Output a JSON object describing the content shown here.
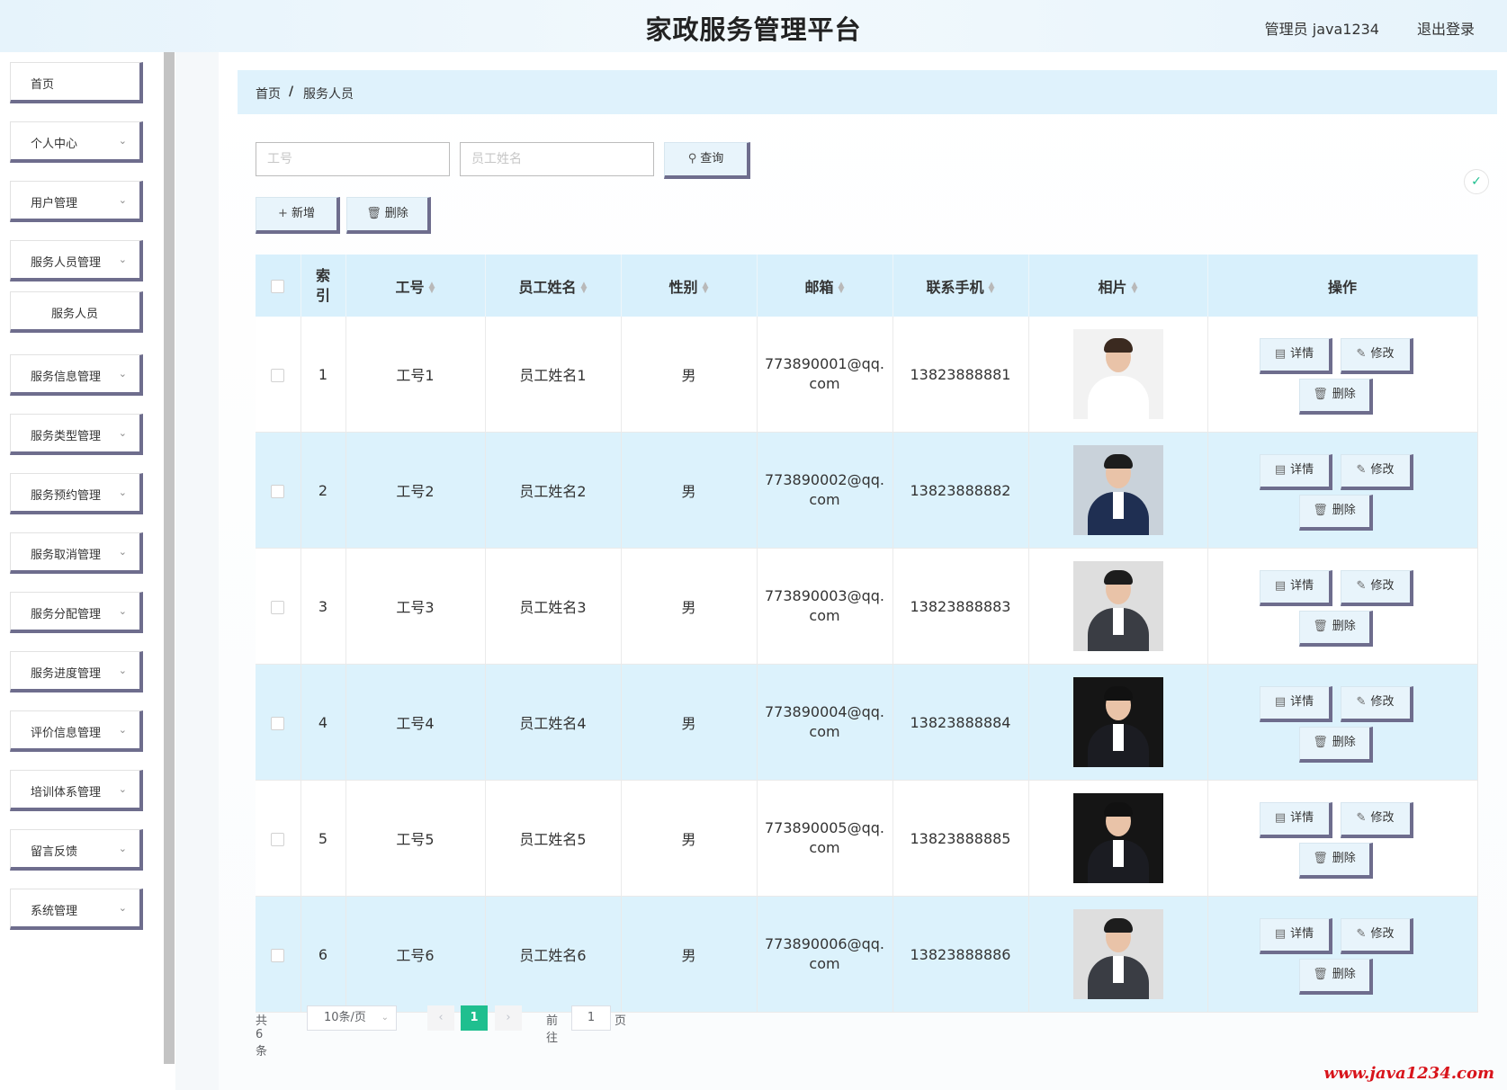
{
  "header": {
    "app_title": "家政服务管理平台",
    "user_label": "管理员 java1234",
    "logout_label": "退出登录"
  },
  "sidebar": {
    "items": [
      {
        "label": "首页",
        "has_chevron": false
      },
      {
        "label": "个人中心",
        "has_chevron": true
      },
      {
        "label": "用户管理",
        "has_chevron": true
      },
      {
        "label": "服务人员管理",
        "has_chevron": true
      },
      {
        "label": "服务人员",
        "has_chevron": false,
        "sub": true
      },
      {
        "label": "服务信息管理",
        "has_chevron": true
      },
      {
        "label": "服务类型管理",
        "has_chevron": true
      },
      {
        "label": "服务预约管理",
        "has_chevron": true
      },
      {
        "label": "服务取消管理",
        "has_chevron": true
      },
      {
        "label": "服务分配管理",
        "has_chevron": true
      },
      {
        "label": "服务进度管理",
        "has_chevron": true
      },
      {
        "label": "评价信息管理",
        "has_chevron": true
      },
      {
        "label": "培训体系管理",
        "has_chevron": true
      },
      {
        "label": "留言反馈",
        "has_chevron": true
      },
      {
        "label": "系统管理",
        "has_chevron": true
      }
    ]
  },
  "breadcrumb": {
    "home": "首页",
    "separator": "/",
    "current": "服务人员"
  },
  "search": {
    "gonghao_placeholder": "工号",
    "name_placeholder": "员工姓名",
    "query_label": "查询"
  },
  "actions": {
    "add_label": "新增",
    "delete_label": "删除"
  },
  "table": {
    "headers": [
      "索引",
      "工号",
      "员工姓名",
      "性别",
      "邮箱",
      "联系手机",
      "相片",
      "操作"
    ],
    "rows": [
      {
        "index": "1",
        "gonghao": "工号1",
        "name": "员工姓名1",
        "gender": "男",
        "email_a": "773890001@qq.",
        "email_b": "com",
        "phone": "13823888881",
        "photo": "female-white-shirt"
      },
      {
        "index": "2",
        "gonghao": "工号2",
        "name": "员工姓名2",
        "gender": "男",
        "email_a": "773890002@qq.",
        "email_b": "com",
        "phone": "13823888882",
        "photo": "male-navy-suit"
      },
      {
        "index": "3",
        "gonghao": "工号3",
        "name": "员工姓名3",
        "gender": "男",
        "email_a": "773890003@qq.",
        "email_b": "com",
        "phone": "13823888883",
        "photo": "male-grey-suit"
      },
      {
        "index": "4",
        "gonghao": "工号4",
        "name": "员工姓名4",
        "gender": "男",
        "email_a": "773890004@qq.",
        "email_b": "com",
        "phone": "13823888884",
        "photo": "male-black-suit"
      },
      {
        "index": "5",
        "gonghao": "工号5",
        "name": "员工姓名5",
        "gender": "男",
        "email_a": "773890005@qq.",
        "email_b": "com",
        "phone": "13823888885",
        "photo": "male-black-suit"
      },
      {
        "index": "6",
        "gonghao": "工号6",
        "name": "员工姓名6",
        "gender": "男",
        "email_a": "773890006@qq.",
        "email_b": "com",
        "phone": "13823888886",
        "photo": "male-grey-suit"
      }
    ],
    "op_detail": "详情",
    "op_edit": "修改",
    "op_delete": "删除"
  },
  "pagination": {
    "total": "共 6 条",
    "page_size": "10条/页",
    "current_page": "1",
    "goto_prefix": "前往",
    "goto_value": "1",
    "goto_suffix": "页"
  },
  "watermark": "www.java1234.com",
  "colors": {
    "accent_border": "#6e6d8d",
    "table_header_bg": "#d8f0fc",
    "stripe_bg": "#dcf2fc",
    "pager_active": "#1fbf8f",
    "watermark": "#d8141b"
  }
}
